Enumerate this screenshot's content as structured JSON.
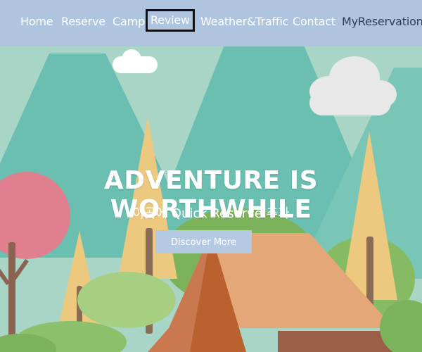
{
  "nav": {
    "items": [
      "Home",
      "Reserve",
      "Camp",
      "Review",
      "Weather&Traffic",
      "Contact",
      "MyReservation"
    ],
    "active": "Review"
  },
  "hero": {
    "headline": "ADVENTURE IS WORTHWHILE",
    "subheadline": "이곳에 Quick Reserve 추가",
    "cta_label": "Discover More"
  },
  "colors": {
    "nav_bg": "#afc4df",
    "sky": "#a8d5c6",
    "mountain": "#6abfb0",
    "tree_yellow": "#ecc97e",
    "tent": "#e4a878",
    "tree_pink": "#e0808e",
    "bush_green": "#7cb35a"
  }
}
